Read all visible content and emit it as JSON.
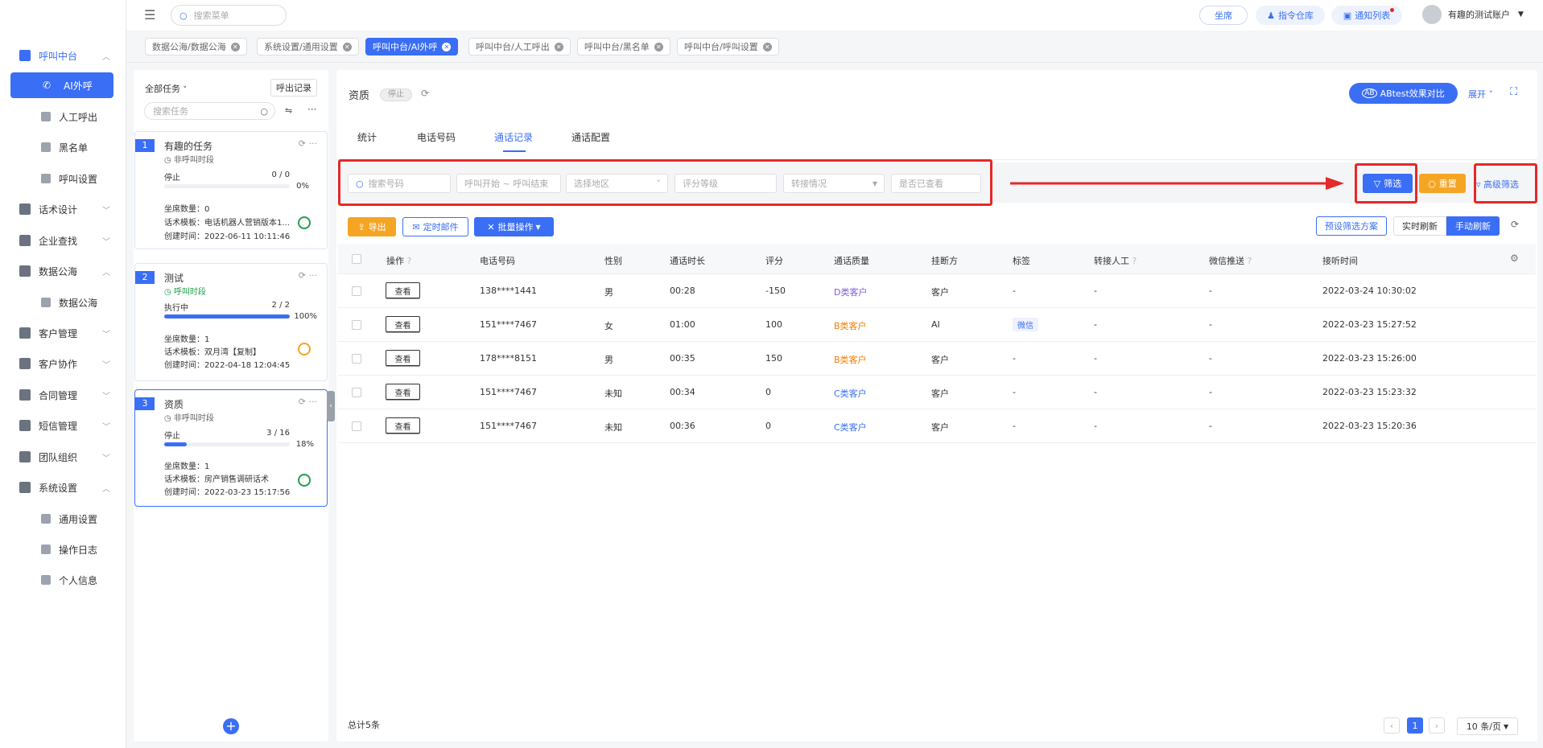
{
  "colors": {
    "primary": "#3a6ef5",
    "warning": "#f5a524",
    "success": "#22a04b",
    "danger": "#e62828",
    "purple": "#7b5cd6"
  },
  "sidebar": {
    "items": [
      {
        "label": "呼叫中台",
        "icon": "monitor-icon"
      },
      {
        "label": "AI外呼",
        "icon": "phone-icon"
      },
      {
        "label": "人工呼出",
        "icon": "user-icon"
      },
      {
        "label": "黑名单",
        "icon": "warning-icon"
      },
      {
        "label": "呼叫设置",
        "icon": "sliders-icon"
      },
      {
        "label": "话术设计",
        "icon": "design-icon"
      },
      {
        "label": "企业查找",
        "icon": "bulb-icon"
      },
      {
        "label": "数据公海",
        "icon": "chart-icon"
      },
      {
        "label": "数据公海",
        "icon": "list-icon"
      },
      {
        "label": "客户管理",
        "icon": "customer-icon"
      },
      {
        "label": "客户协作",
        "icon": "collab-icon"
      },
      {
        "label": "合同管理",
        "icon": "contract-icon"
      },
      {
        "label": "短信管理",
        "icon": "sms-icon"
      },
      {
        "label": "团队组织",
        "icon": "team-icon"
      },
      {
        "label": "系统设置",
        "icon": "grid-icon"
      },
      {
        "label": "通用设置",
        "icon": "gear-icon"
      },
      {
        "label": "操作日志",
        "icon": "log-icon"
      },
      {
        "label": "个人信息",
        "icon": "person-icon"
      }
    ]
  },
  "topbar": {
    "search_placeholder": "搜索菜单",
    "seat": "坐席",
    "command": "指令仓库",
    "notice": "通知列表",
    "account": "有趣的测试账户"
  },
  "tabs": [
    {
      "label": "数据公海/数据公海"
    },
    {
      "label": "系统设置/通用设置"
    },
    {
      "label": "呼叫中台/AI外呼"
    },
    {
      "label": "呼叫中台/人工呼出"
    },
    {
      "label": "呼叫中台/黑名单"
    },
    {
      "label": "呼叫中台/呼叫设置"
    }
  ],
  "tasks": {
    "filter": "全部任务",
    "records_btn": "呼出记录",
    "search_placeholder": "搜索任务",
    "add_icon": "plus-icon",
    "cards": [
      {
        "num": "1",
        "name": "有趣的任务",
        "status": "非呼叫时段",
        "state": "停止",
        "progress": "0 / 0",
        "pct": "0%",
        "fill": 0,
        "seats": "坐席数量：0",
        "template": "话术模板：电话机器人营销版本1...",
        "created": "创建时间：2022-06-11 10:11:46"
      },
      {
        "num": "2",
        "name": "测试",
        "status": "呼叫时段",
        "state": "执行中",
        "progress": "2 / 2",
        "pct": "100%",
        "fill": 100,
        "seats": "坐席数量：1",
        "template": "话术模板：双月湾【复制】",
        "created": "创建时间：2022-04-18 12:04:45"
      },
      {
        "num": "3",
        "name": "资质",
        "status": "非呼叫时段",
        "state": "停止",
        "progress": "3 / 16",
        "pct": "18%",
        "fill": 18,
        "seats": "坐席数量：1",
        "template": "话术模板：房产销售调研话术",
        "created": "创建时间：2022-03-23 15:17:56"
      }
    ]
  },
  "main": {
    "title": "资质",
    "status_badge": "停止",
    "abtest": "ABtest效果对比",
    "expand": "展开",
    "subtabs": [
      "统计",
      "电话号码",
      "通话记录",
      "通话配置"
    ],
    "filters": {
      "phone": "搜索号码",
      "time": "呼叫开始 ~ 呼叫结束",
      "region": "选择地区",
      "grade": "评分等级",
      "transfer": "转接情况",
      "viewed": "是否已查看"
    },
    "filter_btn": "筛选",
    "reset_btn": "重置",
    "advanced_btn": "高级筛选",
    "export_btn": "导出",
    "mail_btn": "定时邮件",
    "batch_btn": "批量操作",
    "preset_btn": "预设筛选方案",
    "realtime_btn": "实时刷新",
    "manual_btn": "手动刷新",
    "total": "总计5条",
    "page": "1",
    "page_size": "10 条/页"
  },
  "table": {
    "headers": [
      "操作",
      "电话号码",
      "性别",
      "通话时长",
      "评分",
      "通话质量",
      "挂断方",
      "标签",
      "转接人工",
      "微信推送",
      "接听时间"
    ],
    "rows": [
      {
        "action": "查看",
        "phone": "138****1441",
        "gender": "男",
        "duration": "00:28",
        "score": "-150",
        "quality": "D类客户",
        "qcolor": "#7b5cd6",
        "hangup": "客户",
        "tag": "-",
        "transfer": "-",
        "wechat": "-",
        "time": "2022-03-24 10:30:02"
      },
      {
        "action": "查看",
        "phone": "151****7467",
        "gender": "女",
        "duration": "01:00",
        "score": "100",
        "quality": "B类客户",
        "qcolor": "#f57c00",
        "hangup": "AI",
        "tag": "微信",
        "transfer": "-",
        "wechat": "-",
        "time": "2022-03-23 15:27:52"
      },
      {
        "action": "查看",
        "phone": "178****8151",
        "gender": "男",
        "duration": "00:35",
        "score": "150",
        "quality": "B类客户",
        "qcolor": "#f57c00",
        "hangup": "客户",
        "tag": "-",
        "transfer": "-",
        "wechat": "-",
        "time": "2022-03-23 15:26:00"
      },
      {
        "action": "查看",
        "phone": "151****7467",
        "gender": "未知",
        "duration": "00:34",
        "score": "0",
        "quality": "C类客户",
        "qcolor": "#3a6ef5",
        "hangup": "客户",
        "tag": "-",
        "transfer": "-",
        "wechat": "-",
        "time": "2022-03-23 15:23:32"
      },
      {
        "action": "查看",
        "phone": "151****7467",
        "gender": "未知",
        "duration": "00:36",
        "score": "0",
        "quality": "C类客户",
        "qcolor": "#3a6ef5",
        "hangup": "客户",
        "tag": "-",
        "transfer": "-",
        "wechat": "-",
        "time": "2022-03-23 15:20:36"
      }
    ]
  }
}
